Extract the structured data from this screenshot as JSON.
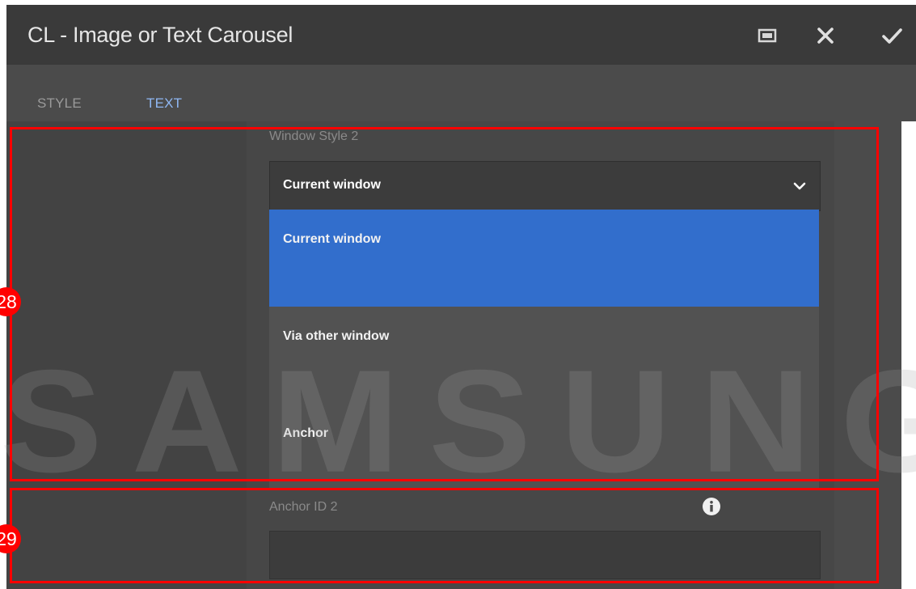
{
  "dialog": {
    "title": "CL - Image or Text Carousel",
    "header_buttons": [
      {
        "icon": "fullscreen-icon"
      },
      {
        "icon": "close-icon"
      },
      {
        "icon": "checkmark-icon"
      }
    ]
  },
  "tabs": [
    {
      "label": "STYLE",
      "active": false
    },
    {
      "label": "TEXT",
      "active": true
    }
  ],
  "window_style": {
    "label": "Window Style 2",
    "selected": "Current window",
    "options": [
      "Current window",
      "Via other window",
      "Anchor"
    ]
  },
  "anchor_id": {
    "label": "Anchor ID 2",
    "value": "",
    "info_icon": "info-icon"
  },
  "annotations": [
    {
      "number": "28"
    },
    {
      "number": "29"
    }
  ],
  "watermark": "SAMSUNG",
  "colors": {
    "header_bg": "#3a3a3a",
    "dialog_bg": "#4b4b4b",
    "active_tab": "#8fb7f2",
    "selected_option_bg": "#326ecc",
    "annotation_red": "#ff0000"
  }
}
